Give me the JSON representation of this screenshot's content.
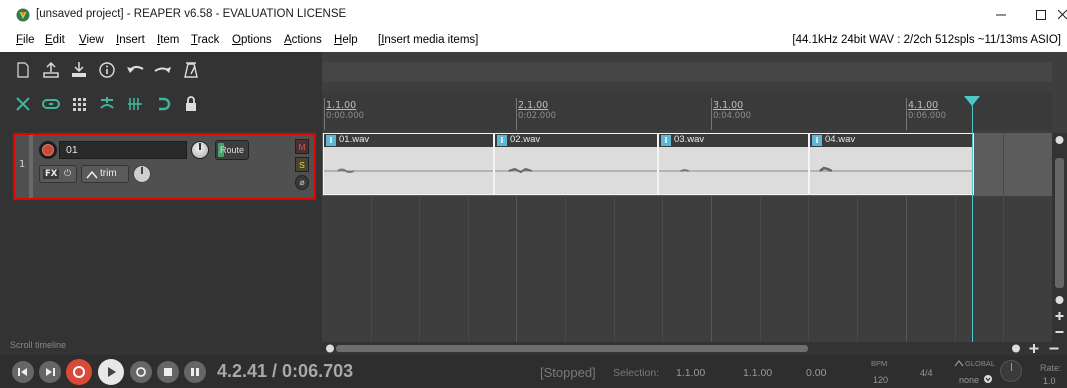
{
  "window": {
    "title": "[unsaved project] - REAPER v6.58 - EVALUATION LICENSE",
    "controls": [
      "minimize",
      "maximize",
      "close"
    ]
  },
  "menu": {
    "items": [
      "File",
      "Edit",
      "View",
      "Insert",
      "Item",
      "Track",
      "Options",
      "Actions",
      "Help"
    ],
    "context": "[Insert media items]",
    "status": "[44.1kHz 24bit WAV : 2/2ch 512spls ~11/13ms ASIO]"
  },
  "toolbar": {
    "row1_icons": [
      "new-project-icon",
      "open-project-icon",
      "save-project-icon",
      "project-info-icon",
      "undo-icon",
      "redo-icon",
      "metronome-icon"
    ],
    "row2_icons": [
      "ripple-edit-icon",
      "loop-icon",
      "grid-icon",
      "snap-icon",
      "item-grid-icon",
      "cycle-icon",
      "lock-icon"
    ]
  },
  "ruler": {
    "marks": [
      {
        "bar": "1.1.00",
        "time": "0:00.000"
      },
      {
        "bar": "2.1.00",
        "time": "0:02.000"
      },
      {
        "bar": "3.1.00",
        "time": "0:04.000"
      },
      {
        "bar": "4.1.00",
        "time": "0:06.000"
      }
    ]
  },
  "track": {
    "number": "1",
    "name": "01",
    "route_label": "Route",
    "fx_label": "FX",
    "fx_power": "⏻",
    "trim_label": "trim",
    "mute_label": "M",
    "solo_label": "S",
    "phase_label": "⌀"
  },
  "items": [
    {
      "name": "01.wav",
      "badge": "i"
    },
    {
      "name": "02.wav",
      "badge": "i"
    },
    {
      "name": "03.wav",
      "badge": "i"
    },
    {
      "name": "04.wav",
      "badge": "i"
    }
  ],
  "scroll_label": "Scroll timeline",
  "transport": {
    "position": "4.2.41 / 0:06.703",
    "status": "[Stopped]",
    "selection_label": "Selection:",
    "selection_start": "1.1.00",
    "selection_end": "1.1.00",
    "selection_length": "0.00",
    "bpm_label": "BPM",
    "bpm_value": "120",
    "time_signature": "4/4",
    "global_label": "GLOBAL",
    "global_value": "none",
    "rate_label": "Rate:",
    "rate_value": "1.0"
  },
  "colors": {
    "accent_cursor": "#4ec7c7",
    "selection_border": "#e60000",
    "record_red": "#c64a35",
    "item_badge": "#5db6d8"
  }
}
